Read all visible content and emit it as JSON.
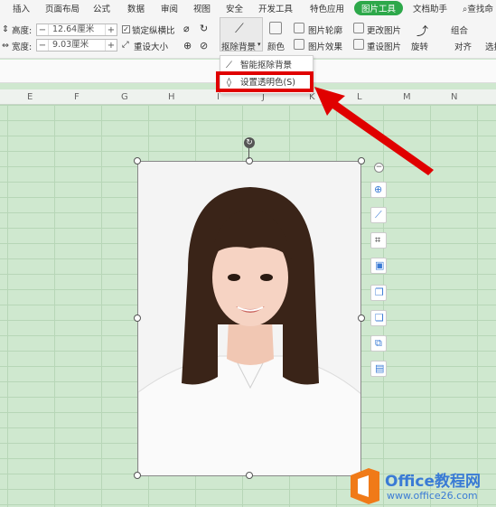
{
  "menu": {
    "items": [
      "插入",
      "页面布局",
      "公式",
      "数据",
      "审阅",
      "视图",
      "安全",
      "开发工具",
      "特色应用"
    ],
    "active": "图片工具",
    "extra": "文档助手",
    "search": "查找命"
  },
  "ribbon": {
    "height_label": "高度:",
    "height_value": "12.64厘米",
    "width_label": "宽度:",
    "width_value": "9.03厘米",
    "lock_ratio": "锁定纵横比",
    "reset_size": "重设大小",
    "remove_bg": "抠除背景",
    "color": "颜色",
    "outline": "图片轮廓",
    "effects": "图片效果",
    "change_pic": "更改图片",
    "reset_pic": "重设图片",
    "rotate": "旋转",
    "group": "组合",
    "align": "对齐",
    "select": "选择"
  },
  "dropdown": {
    "smart_remove": "智能抠除背景",
    "set_transparent": "设置透明色(S)"
  },
  "columns": [
    "E",
    "F",
    "G",
    "H",
    "I",
    "J",
    "K",
    "L",
    "M",
    "N"
  ],
  "watermark": {
    "brand": "Office教程网",
    "url": "www.office26.com"
  },
  "colors": {
    "accent": "#2da84a",
    "highlight": "#e00000",
    "sheet": "#cfe8cf",
    "logo_orange": "#f07a18"
  }
}
